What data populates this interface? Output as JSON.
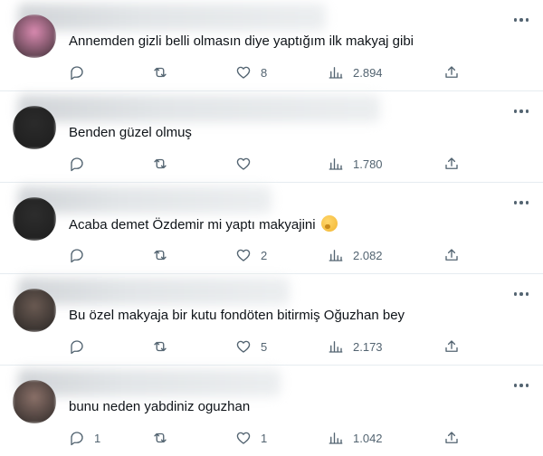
{
  "replies": [
    {
      "text": "Annemden gizli belli olmasın diye yaptığım ilk makyaj gibi",
      "replies": "",
      "retweets": "",
      "likes": "8",
      "views": "2.894",
      "avatar_color": "#d98ab0",
      "emoji": ""
    },
    {
      "text": "Benden güzel olmuş",
      "replies": "",
      "retweets": "",
      "likes": "",
      "views": "1.780",
      "avatar_color": "#2b2b2b",
      "emoji": ""
    },
    {
      "text": "Acaba demet Özdemir mi yaptı makyajini",
      "replies": "",
      "retweets": "",
      "likes": "2",
      "views": "2.082",
      "avatar_color": "#2d2d2d",
      "emoji": "thinking-face"
    },
    {
      "text": "Bu özel makyaja bir kutu fondöten bitirmiş Oğuzhan bey",
      "replies": "",
      "retweets": "",
      "likes": "5",
      "views": "2.173",
      "avatar_color": "#6a5a52",
      "emoji": ""
    },
    {
      "text": "bunu neden yabdiniz oguzhan",
      "replies": "1",
      "retweets": "",
      "likes": "1",
      "views": "1.042",
      "avatar_color": "#8a7068",
      "emoji": ""
    }
  ],
  "icons": {
    "reply": "reply-icon",
    "retweet": "retweet-icon",
    "like": "heart-icon",
    "views": "views-icon",
    "share": "share-icon",
    "more": "more-icon"
  },
  "colors": {
    "text": "#0f1419",
    "secondary": "#536471",
    "divider": "#e6ecf0"
  }
}
